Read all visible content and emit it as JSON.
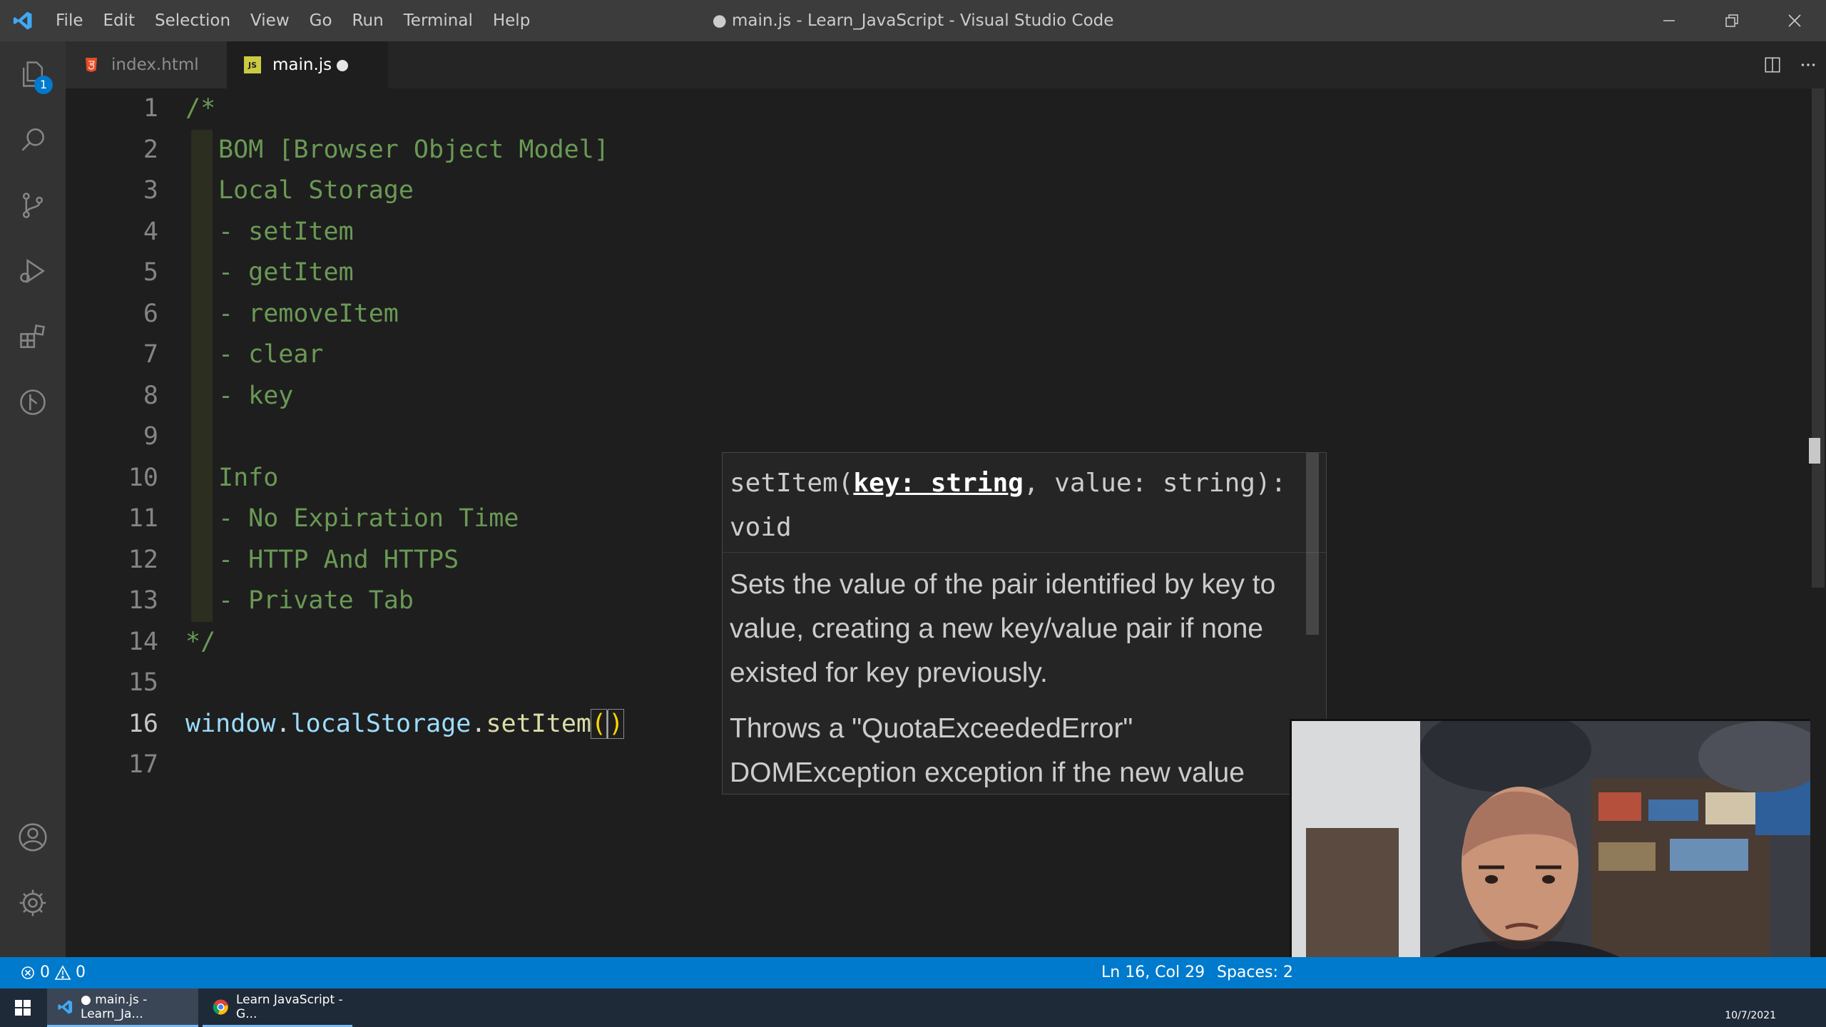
{
  "window": {
    "title": "● main.js - Learn_JavaScript - Visual Studio Code"
  },
  "menu": [
    "File",
    "Edit",
    "Selection",
    "View",
    "Go",
    "Run",
    "Terminal",
    "Help"
  ],
  "activity_bar": {
    "icons": [
      "explorer-icon",
      "search-icon",
      "source-control-icon",
      "run-debug-icon",
      "extensions-icon",
      "timeline-icon",
      "accounts-icon",
      "settings-gear-icon"
    ],
    "explorer_badge": "1"
  },
  "tabs": [
    {
      "label": "index.html",
      "icon": "html5-icon",
      "active": false
    },
    {
      "label": "main.js",
      "icon": "js-icon",
      "active": true,
      "dirty": true
    }
  ],
  "editor": {
    "line_numbers": [
      "1",
      "2",
      "3",
      "4",
      "5",
      "6",
      "7",
      "8",
      "9",
      "10",
      "11",
      "12",
      "13",
      "14",
      "15",
      "16",
      "17"
    ],
    "current_line": 16,
    "lines": [
      "/*",
      "BOM [Browser Object Model]",
      "Local Storage",
      "- setItem",
      "- getItem",
      "- removeItem",
      "- clear",
      "- key",
      "",
      "Info",
      "- No Expiration Time",
      "- HTTP And HTTPS",
      "- Private Tab",
      "*/",
      "",
      "window.localStorage.setItem()",
      ""
    ],
    "code16": {
      "obj": "window",
      "prop": "localStorage",
      "method": "setItem",
      "open": "(",
      "close": ")"
    }
  },
  "parameter_hint": {
    "sig_name": "setItem(",
    "sig_active_param": "key: string",
    "sig_rest": ", value: string): void",
    "doc_1": "Sets the value of the pair identified by key to value, creating a new key/value pair if none existed for key previously.",
    "doc_2": "Throws a \"QuotaExceededError\" DOMException exception if the new value"
  },
  "status_bar": {
    "errors": "0",
    "warnings": "0",
    "position": "Ln 16, Col 29",
    "indent": "Spaces: 2"
  },
  "taskbar": {
    "tasks": [
      "● main.js - Learn_Ja...",
      "Learn JavaScript - G..."
    ],
    "date": "10/7/2021"
  },
  "colors": {
    "accent": "#007acc",
    "comment": "#6a9955",
    "identifier": "#9cdcfe",
    "function": "#dcdcaa",
    "bracket": "#ffd700"
  }
}
